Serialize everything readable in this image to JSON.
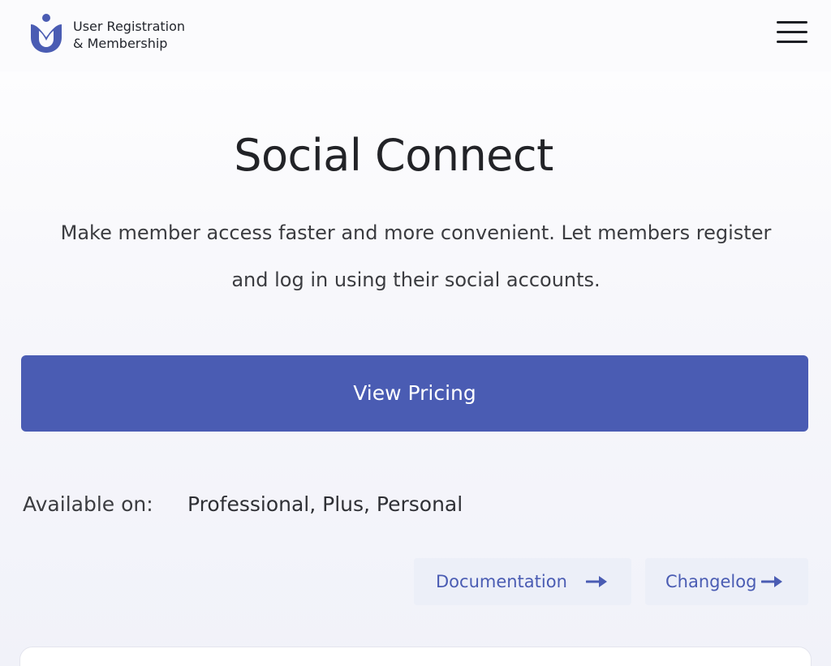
{
  "header": {
    "brand_line1": "User Registration",
    "brand_line2": "& Membership",
    "logo_icon": "user-registration-logo-icon",
    "menu_icon": "hamburger-menu-icon"
  },
  "hero": {
    "title": "Social Connect",
    "description_line1": "Make member access faster and more convenient. Let members register",
    "description_line2": "and log in using their social accounts."
  },
  "cta": {
    "pricing_label": "View Pricing"
  },
  "availability": {
    "label": "Available on:",
    "plans": "Professional, Plus, Personal"
  },
  "links": {
    "documentation_label": "Documentation",
    "changelog_label": "Changelog",
    "arrow_icon": "arrow-right-icon"
  },
  "colors": {
    "accent": "#4a5cb3",
    "link_bg": "#eceff8",
    "text": "#222327"
  }
}
